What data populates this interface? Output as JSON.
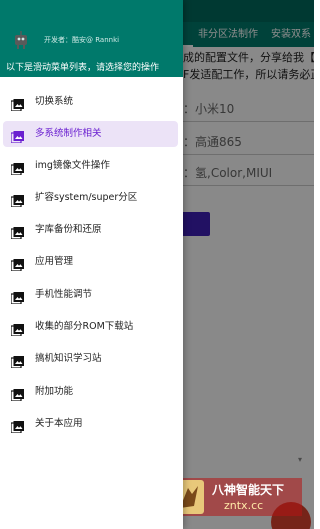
{
  "app": {
    "tabs": [
      "非分区法制作",
      "安装双系"
    ],
    "description_lines": [
      "成的配置文件，分享给我【酷",
      "F发适配工作，所以请务必正"
    ],
    "fields": [
      "：小米10",
      "：高通865",
      "：氢,Color,MIUI"
    ],
    "overflow_indicator": "▾"
  },
  "drawer": {
    "author": "开发者：酷安@ Rannki",
    "hint": "以下是滑动菜单列表，请选择您的操作",
    "active_index": 1,
    "items": [
      {
        "label": "切换系统",
        "icon": "image-icon"
      },
      {
        "label": "多系统制作相关",
        "icon": "image-icon"
      },
      {
        "label": "img镜像文件操作",
        "icon": "image-icon"
      },
      {
        "label": "扩容system/super分区",
        "icon": "image-icon"
      },
      {
        "label": "字库备份和还原",
        "icon": "image-icon"
      },
      {
        "label": "应用管理",
        "icon": "image-icon"
      },
      {
        "label": "手机性能调节",
        "icon": "image-icon"
      },
      {
        "label": "收集的部分ROM下载站",
        "icon": "image-icon"
      },
      {
        "label": "搞机知识学习站",
        "icon": "image-icon"
      },
      {
        "label": "附加功能",
        "icon": "image-icon"
      },
      {
        "label": "关于本应用",
        "icon": "image-icon"
      }
    ]
  },
  "watermark": {
    "title": "八神智能天下",
    "url": "zntx.cc"
  },
  "colors": {
    "primary": "#00796b",
    "accent": "#6a1fd0",
    "active_bg": "#ece3f7"
  }
}
